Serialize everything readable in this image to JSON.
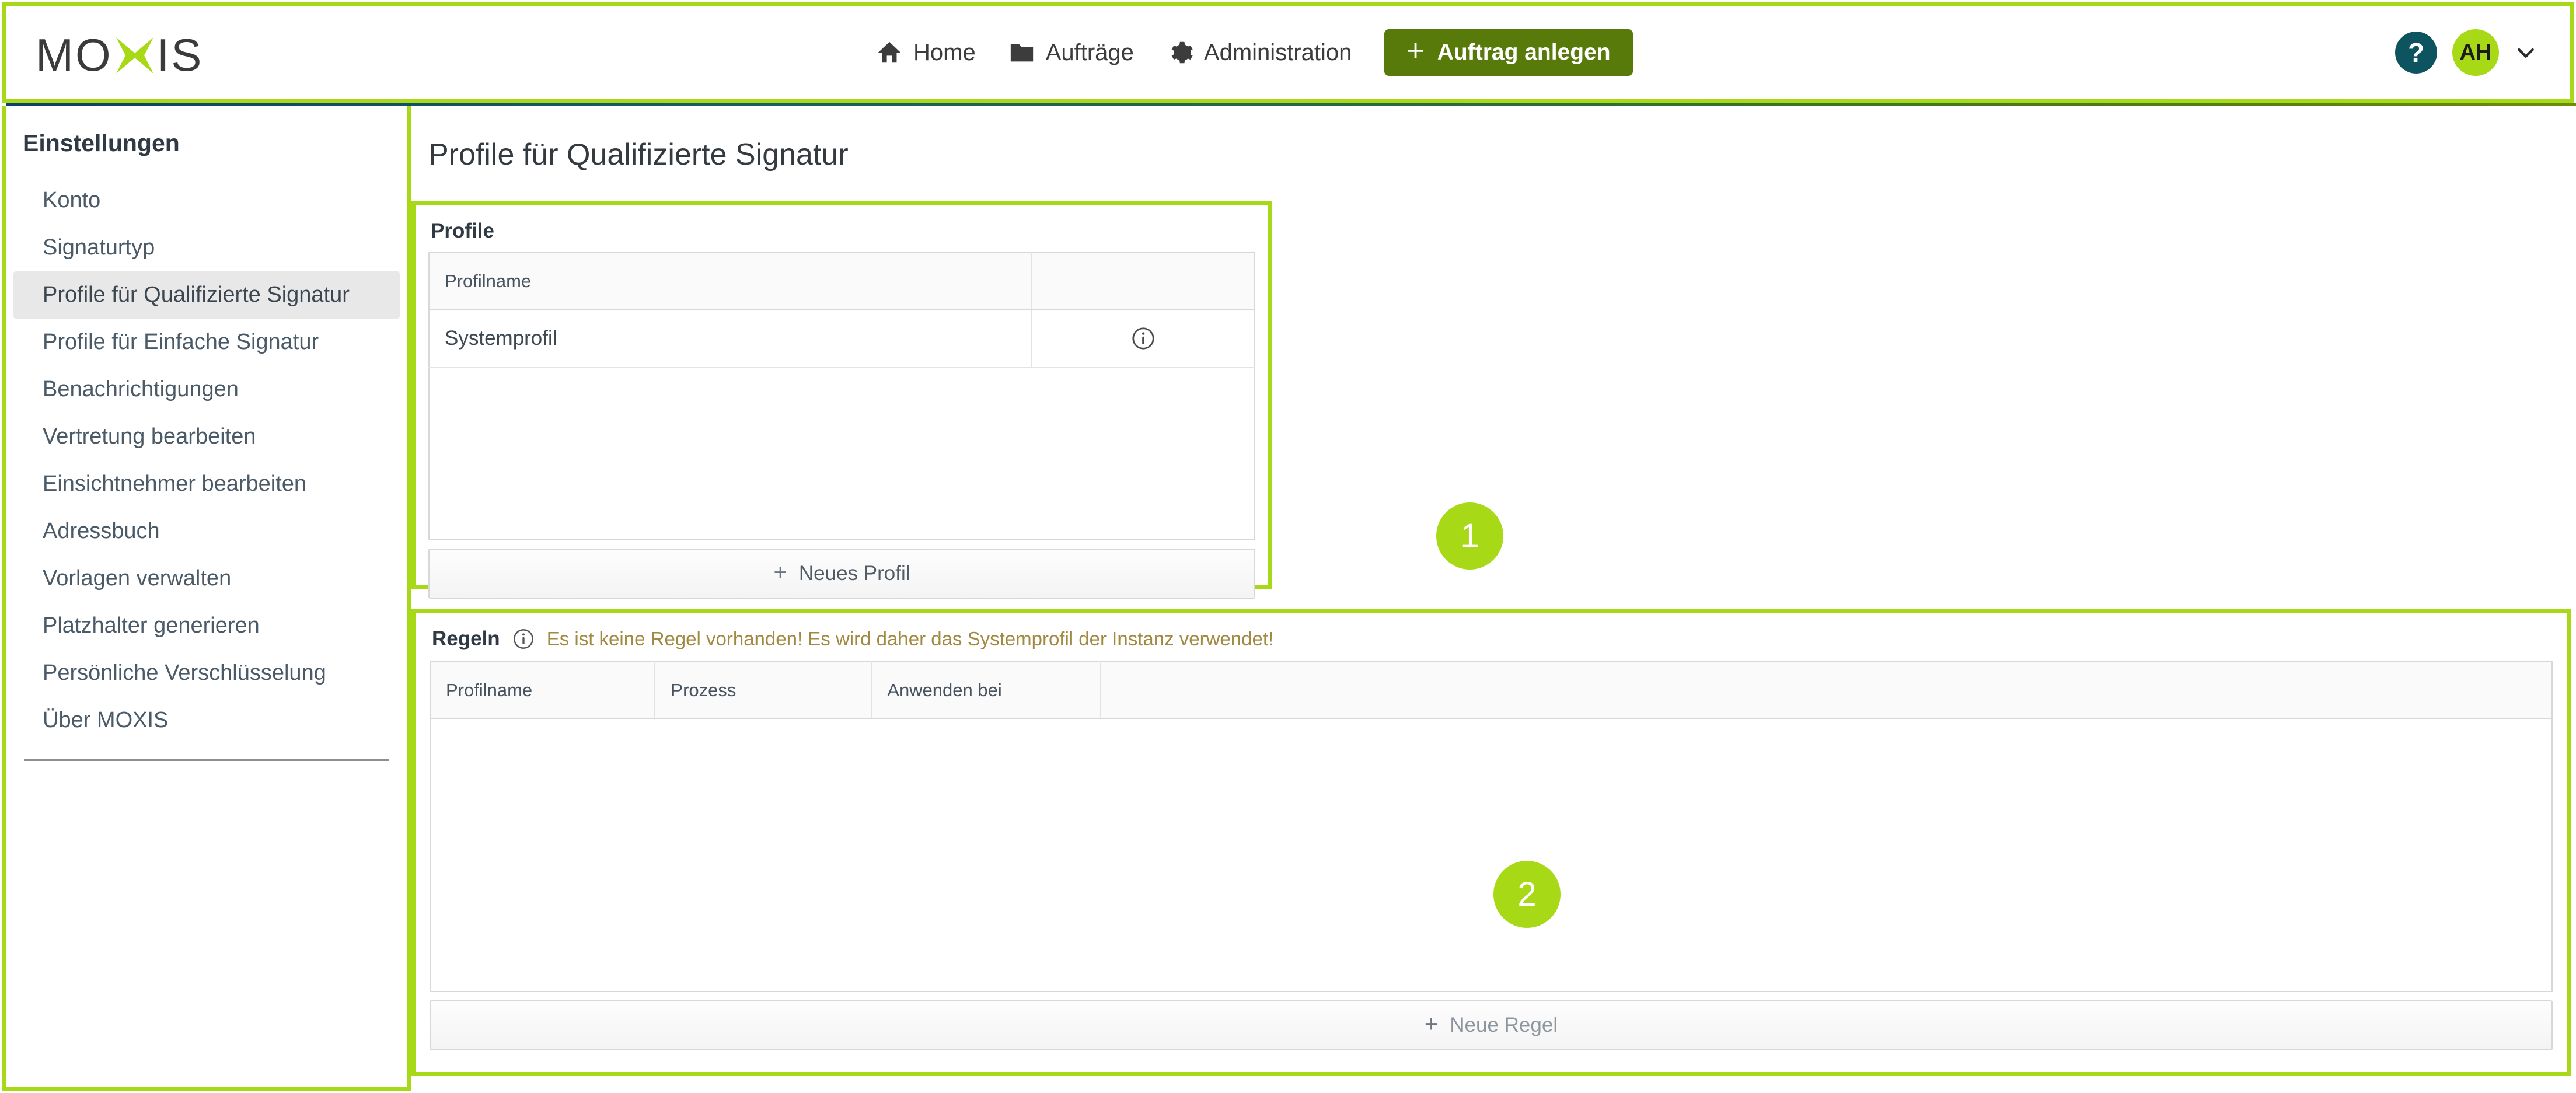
{
  "brand": {
    "logo_left": "MO",
    "logo_icon": "x-star-icon",
    "logo_right": "IS",
    "accent_green": "#A8D916",
    "button_green": "#587A0B",
    "help_teal": "#0D5460",
    "warning_gold": "#A08940"
  },
  "header": {
    "nav": [
      {
        "label": "Home",
        "icon": "home-icon"
      },
      {
        "label": "Aufträge",
        "icon": "folder-icon"
      },
      {
        "label": "Administration",
        "icon": "gear-icon"
      }
    ],
    "create_button": {
      "label": "Auftrag anlegen",
      "icon": "plus-icon"
    },
    "help": {
      "label": "?",
      "icon": "question-mark-icon"
    },
    "avatar": {
      "initials": "AH",
      "caret": "chevron-down-icon"
    }
  },
  "sidebar": {
    "title": "Einstellungen",
    "items": [
      {
        "label": "Konto",
        "active": false
      },
      {
        "label": "Signaturtyp",
        "active": false
      },
      {
        "label": "Profile für Qualifizierte Signatur",
        "active": true
      },
      {
        "label": "Profile für Einfache Signatur",
        "active": false
      },
      {
        "label": "Benachrichtigungen",
        "active": false
      },
      {
        "label": "Vertretung bearbeiten",
        "active": false
      },
      {
        "label": "Einsichtnehmer bearbeiten",
        "active": false
      },
      {
        "label": "Adressbuch",
        "active": false
      },
      {
        "label": "Vorlagen verwalten",
        "active": false
      },
      {
        "label": "Platzhalter generieren",
        "active": false
      },
      {
        "label": "Persönliche Verschlüsselung",
        "active": false
      },
      {
        "label": "Über MOXIS",
        "active": false
      }
    ]
  },
  "main": {
    "page_title": "Profile für Qualifizierte Signatur",
    "profile_panel": {
      "legend": "Profile",
      "columns": [
        "Profilname",
        ""
      ],
      "rows": [
        {
          "profilname": "Systemprofil",
          "action_icon": "info-circle-icon"
        }
      ],
      "add_button": {
        "label": "Neues Profil",
        "icon": "plus-icon"
      },
      "badge": "1"
    },
    "regeln_panel": {
      "legend": "Regeln",
      "warning_icon": "info-circle-icon",
      "warning_text": "Es ist keine Regel vorhanden! Es wird daher das Systemprofil der Instanz verwendet!",
      "columns": [
        "Profilname",
        "Prozess",
        "Anwenden bei",
        ""
      ],
      "rows": [],
      "add_button": {
        "label": "Neue Regel",
        "icon": "plus-icon"
      },
      "badge": "2"
    }
  }
}
